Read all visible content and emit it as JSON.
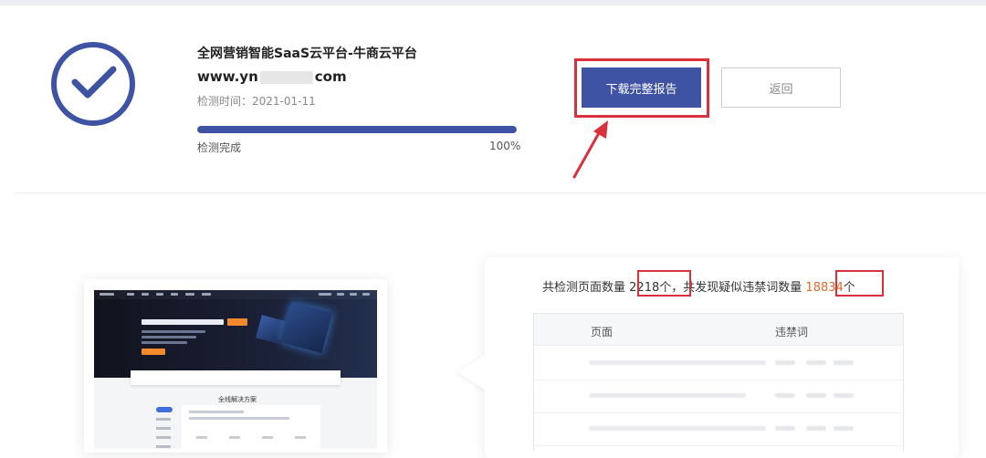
{
  "header": {
    "site_title": "全网营销智能SaaS云平台-牛商云平台",
    "url_prefix": "www.yn",
    "url_suffix": "com",
    "detect_time": "检测时间：2021-01-11",
    "progress_status": "检测完成",
    "progress_percent_label": "100%",
    "progress_value": 1.0
  },
  "actions": {
    "download_label": "下载完整报告",
    "back_label": "返回"
  },
  "result": {
    "summary_prefix": "共检测页面数量",
    "pages_count": "2218",
    "pages_unit": "个",
    "summary_middle": "，共发现疑似违禁词数量",
    "words_count": "18834",
    "words_unit": "个",
    "table_headers": {
      "page": "页面",
      "word": "违禁词"
    }
  },
  "preview": {
    "section_title": "全线解决方案"
  },
  "colors": {
    "accent": "#3f53a4",
    "highlight": "#d9303c",
    "number": "#e06a2c"
  }
}
